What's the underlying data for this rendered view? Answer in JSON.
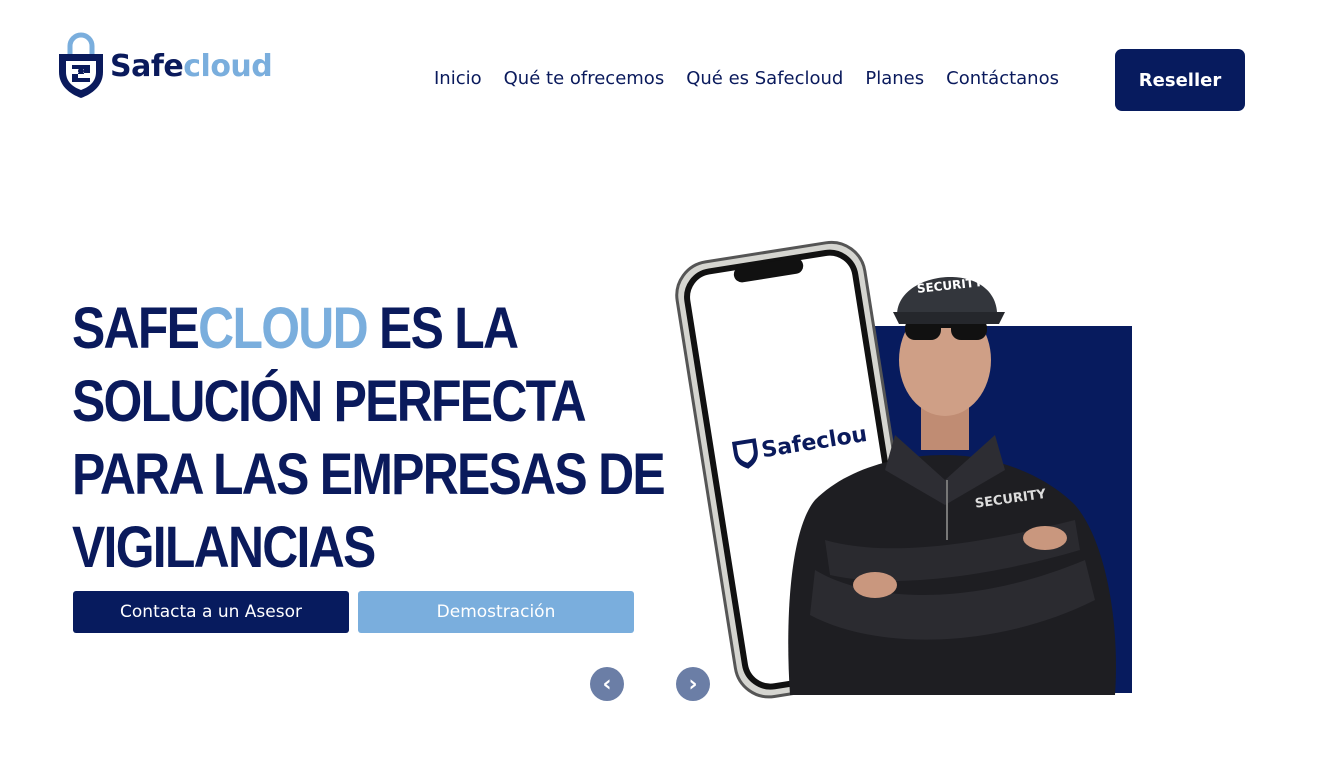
{
  "brand": {
    "name_part1": "Safe",
    "name_part2": "cloud"
  },
  "nav": {
    "items": [
      "Inicio",
      "Qué te ofrecemos",
      "Qué es Safecloud",
      "Planes",
      "Contáctanos"
    ],
    "cta_label": "Reseller"
  },
  "hero": {
    "headline_part1": "SAFE",
    "headline_accent": "CLOUD",
    "headline_line1_rest": " ES LA",
    "headline_line2": "SOLUCIÓN PERFECTA",
    "headline_line3": "PARA LAS EMPRESAS DE",
    "headline_line4": "VIGILANCIAS",
    "primary_button": "Contacta a un Asesor",
    "secondary_button": "Demostración",
    "image": {
      "phone_logo_text": "Safeclou",
      "cap_text": "SECURITY",
      "jacket_text": "SECURITY"
    }
  },
  "carousel": {
    "prev_icon": "chevron-left-icon",
    "next_icon": "chevron-right-icon"
  },
  "colors": {
    "navy": "#071b5e",
    "light_blue": "#7aaedd",
    "arrow_gray": "#6b7ea6"
  }
}
